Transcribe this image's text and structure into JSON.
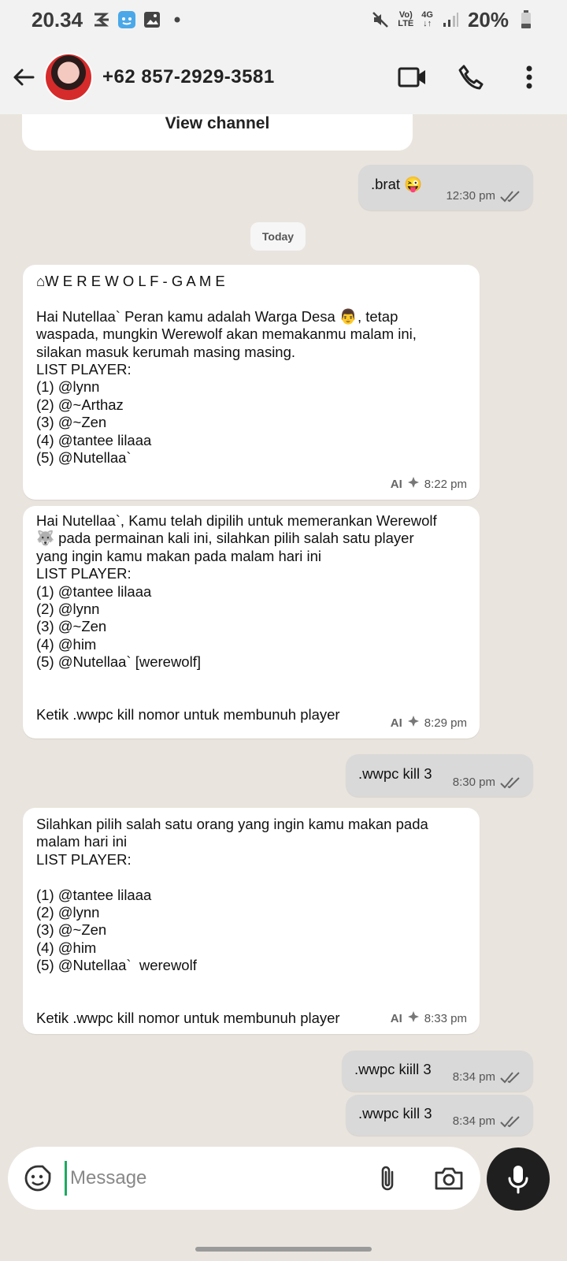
{
  "status_bar": {
    "time": "20.34",
    "network_top": "Vo)",
    "network_bottom": "LTE",
    "net_gen_top": "4G",
    "net_gen_bottom": "↓↑",
    "battery": "20%"
  },
  "header": {
    "contact": "+62 857-2929-3581"
  },
  "chat": {
    "view_channel": "View channel",
    "date_divider": "Today",
    "messages": [
      {
        "direction": "out",
        "text": ".brat 😜",
        "time": "12:30 pm"
      },
      {
        "direction": "in",
        "text": "⌂W E R E W O L F - G A M E\n\nHai Nutellaa` Peran kamu adalah Warga Desa 👨, tetap waspada, mungkin Werewolf akan memakanmu malam ini, silakan masuk kerumah masing masing.\nLIST PLAYER:\n(1) @lynn\n(2) @~Arthaz\n(3) @~Zen\n(4) @tantee lilaaa\n(5) @Nutellaa`",
        "ai_label": "AI",
        "time": "8:22 pm"
      },
      {
        "direction": "in",
        "text": "Hai Nutellaa`, Kamu telah dipilih untuk memerankan Werewolf 🐺 pada permainan kali ini, silahkan pilih salah satu player yang ingin kamu makan pada malam hari ini\nLIST PLAYER:\n(1) @tantee lilaaa\n(2) @lynn\n(3) @~Zen\n(4) @him\n(5) @Nutellaa` [werewolf]\n\n\nKetik .wwpc kill nomor untuk membunuh player",
        "ai_label": "AI",
        "time": "8:29 pm"
      },
      {
        "direction": "out",
        "text": ".wwpc kill 3",
        "time": "8:30 pm"
      },
      {
        "direction": "in",
        "text": "Silahkan pilih salah satu orang yang ingin kamu makan pada malam hari ini\nLIST PLAYER:\n\n(1) @tantee lilaaa\n(2) @lynn\n(3) @~Zen\n(4) @him\n(5) @Nutellaa`  werewolf\n\n\nKetik .wwpc kill nomor untuk membunuh player",
        "ai_label": "AI",
        "time": "8:33 pm"
      },
      {
        "direction": "out",
        "text": ".wwpc kiill 3",
        "time": "8:34 pm"
      },
      {
        "direction": "out",
        "text": ".wwpc kill 3",
        "time": "8:34 pm"
      }
    ]
  },
  "composer": {
    "placeholder": "Message"
  },
  "icons": {
    "back": "arrow-left-icon",
    "video": "video-call-icon",
    "call": "phone-icon",
    "menu": "more-vert-icon",
    "emoji": "emoji-icon",
    "attach": "paperclip-icon",
    "camera": "camera-icon",
    "mic": "microphone-icon",
    "read": "double-check-icon",
    "ai": "sparkle-icon"
  },
  "colors": {
    "chat_bg": "#e9e4dd",
    "incoming": "#ffffff",
    "outgoing": "#d9d9d9",
    "cursor": "#1daa61"
  }
}
